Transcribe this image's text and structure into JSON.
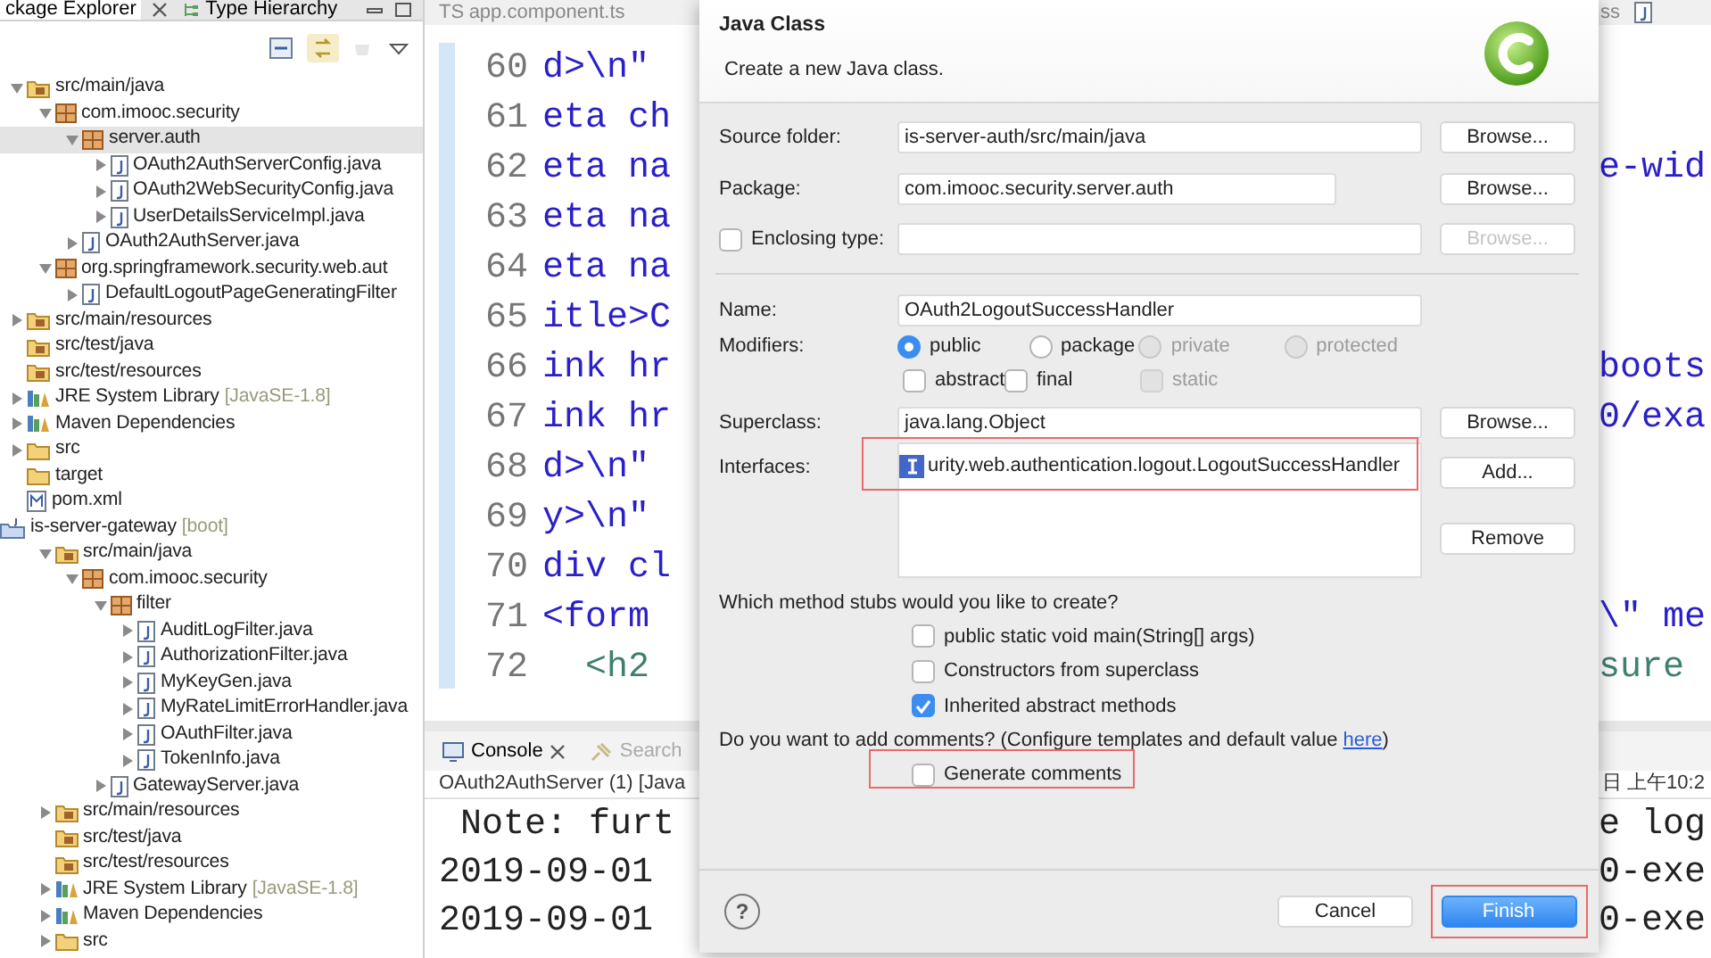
{
  "package_explorer": {
    "tabs": [
      {
        "label": "ckage Explorer",
        "selected": true
      },
      {
        "label": "Type Hierarchy",
        "selected": false
      }
    ],
    "tree": [
      {
        "label": "src/main/java",
        "kind": "source-folder",
        "expanded": true,
        "selected": false,
        "children": [
          {
            "label": "com.imooc.security",
            "kind": "package",
            "expanded": true,
            "selected": false,
            "children": [
              {
                "label": "server.auth",
                "kind": "package",
                "expanded": true,
                "selected": true,
                "children": [
                  {
                    "label": "OAuth2AuthServerConfig.java",
                    "kind": "java-file",
                    "expanded": false,
                    "selected": false
                  },
                  {
                    "label": "OAuth2WebSecurityConfig.java",
                    "kind": "java-file",
                    "expanded": false,
                    "selected": false
                  },
                  {
                    "label": "UserDetailsServiceImpl.java",
                    "kind": "java-file",
                    "expanded": false,
                    "selected": false
                  }
                ]
              },
              {
                "label": "OAuth2AuthServer.java",
                "kind": "java-file",
                "expanded": false,
                "selected": false
              }
            ]
          },
          {
            "label": "org.springframework.security.web.aut",
            "kind": "package",
            "expanded": true,
            "selected": false,
            "children": [
              {
                "label": "DefaultLogoutPageGeneratingFilter",
                "kind": "java-file",
                "expanded": false,
                "selected": false
              }
            ]
          }
        ]
      },
      {
        "label": "src/main/resources",
        "kind": "source-folder",
        "expanded": false,
        "selected": false
      },
      {
        "label": "src/test/java",
        "kind": "source-folder",
        "selected": false
      },
      {
        "label": "src/test/resources",
        "kind": "source-folder",
        "selected": false
      },
      {
        "label": "JRE System Library",
        "decoration": "[JavaSE-1.8]",
        "kind": "library",
        "expanded": false,
        "selected": false
      },
      {
        "label": "Maven Dependencies",
        "kind": "library",
        "expanded": false,
        "selected": false
      },
      {
        "label": "src",
        "kind": "folder",
        "expanded": false,
        "selected": false
      },
      {
        "label": "target",
        "kind": "folder",
        "selected": false
      },
      {
        "label": "pom.xml",
        "kind": "xml-file",
        "selected": false
      },
      {
        "label": "is-server-gateway",
        "decoration": "[boot]",
        "kind": "project",
        "selected": false,
        "children": [
          {
            "label": "src/main/java",
            "kind": "source-folder",
            "expanded": true,
            "selected": false,
            "children": [
              {
                "label": "com.imooc.security",
                "kind": "package",
                "expanded": true,
                "selected": false,
                "children": [
                  {
                    "label": "filter",
                    "kind": "package",
                    "expanded": true,
                    "selected": false,
                    "children": [
                      {
                        "label": "AuditLogFilter.java",
                        "kind": "java-file",
                        "expanded": false,
                        "selected": false
                      },
                      {
                        "label": "AuthorizationFilter.java",
                        "kind": "java-file",
                        "expanded": false,
                        "selected": false
                      },
                      {
                        "label": "MyKeyGen.java",
                        "kind": "java-file",
                        "expanded": false,
                        "selected": false
                      },
                      {
                        "label": "MyRateLimitErrorHandler.java",
                        "kind": "java-file",
                        "expanded": false,
                        "selected": false
                      },
                      {
                        "label": "OAuthFilter.java",
                        "kind": "java-file",
                        "expanded": false,
                        "selected": false
                      },
                      {
                        "label": "TokenInfo.java",
                        "kind": "java-file",
                        "expanded": false,
                        "selected": false
                      }
                    ]
                  },
                  {
                    "label": "GatewayServer.java",
                    "kind": "java-file",
                    "expanded": false,
                    "selected": false
                  }
                ]
              }
            ]
          },
          {
            "label": "src/main/resources",
            "kind": "source-folder",
            "expanded": false,
            "selected": false
          },
          {
            "label": "src/test/java",
            "kind": "source-folder",
            "selected": false
          },
          {
            "label": "src/test/resources",
            "kind": "source-folder",
            "selected": false
          },
          {
            "label": "JRE System Library",
            "decoration": "[JavaSE-1.8]",
            "kind": "library",
            "expanded": false,
            "selected": false
          },
          {
            "label": "Maven Dependencies",
            "kind": "library",
            "expanded": false,
            "selected": false
          },
          {
            "label": "src",
            "kind": "folder",
            "expanded": false,
            "selected": false
          }
        ]
      }
    ]
  },
  "editor": {
    "tab": {
      "icon_text": "TS",
      "label": "app.component.ts"
    },
    "tab_2": {
      "label": "ss"
    },
    "lines": [
      {
        "number": "60",
        "left": "d>\\n\"",
        "kind": "string"
      },
      {
        "number": "61",
        "left": "eta ch",
        "kind": "string"
      },
      {
        "number": "62",
        "left": "eta na",
        "right": "e-wid",
        "kind": "string"
      },
      {
        "number": "63",
        "left": "eta na",
        "kind": "string"
      },
      {
        "number": "64",
        "left": "eta na",
        "kind": "string"
      },
      {
        "number": "65",
        "left": "itle>C",
        "kind": "string"
      },
      {
        "number": "66",
        "left": "ink hr",
        "right": "boots",
        "kind": "string"
      },
      {
        "number": "67",
        "left": "ink hr",
        "right": "0/exa",
        "kind": "string"
      },
      {
        "number": "68",
        "left": "d>\\n\"",
        "kind": "string"
      },
      {
        "number": "69",
        "left": "y>\\n\"",
        "kind": "string"
      },
      {
        "number": "70",
        "left": "div cl",
        "kind": "string"
      },
      {
        "number": "71",
        "left": "<form",
        "right": "\\\" me",
        "kind": "string"
      },
      {
        "number": "72",
        "left": "  <h2",
        "right": "sure",
        "kind": "tag"
      }
    ]
  },
  "console": {
    "tabs": [
      {
        "label": "Console",
        "selected": true
      },
      {
        "label": "Search",
        "selected": false
      }
    ],
    "title": "OAuth2AuthServer (1) [Java",
    "title_right": "日 上午10:2",
    "lines": [
      {
        "left": " Note: furt",
        "right": "e log"
      },
      {
        "left": "2019-09-01",
        "right": "0-exe"
      },
      {
        "left": "2019-09-01",
        "right": "0-exe"
      }
    ]
  },
  "dialog": {
    "title": "Java Class",
    "subtitle": "Create a new Java class.",
    "source_folder": {
      "label": "Source folder:",
      "value": "is-server-auth/src/main/java",
      "button": {
        "label": "Browse...",
        "disabled": false
      }
    },
    "package": {
      "label": "Package:",
      "value": "com.imooc.security.server.auth",
      "button": {
        "label": "Browse...",
        "disabled": false
      }
    },
    "enclosing_type": {
      "label": "Enclosing type:",
      "checked": false,
      "button": {
        "label": "Browse...",
        "disabled": true
      }
    },
    "name": {
      "label": "Name:",
      "value": "OAuth2LogoutSuccessHandler"
    },
    "modifiers": {
      "label": "Modifiers:",
      "access": [
        {
          "label": "public",
          "selected": true,
          "disabled": false
        },
        {
          "label": "package",
          "selected": false,
          "disabled": false
        },
        {
          "label": "private",
          "selected": false,
          "disabled": true
        },
        {
          "label": "protected",
          "selected": false,
          "disabled": true
        }
      ],
      "flags": [
        {
          "label": "abstract",
          "checked": false,
          "disabled": false
        },
        {
          "label": "final",
          "checked": false,
          "disabled": false
        },
        {
          "label": "static",
          "checked": false,
          "disabled": true
        }
      ]
    },
    "superclass": {
      "label": "Superclass:",
      "value": "java.lang.Object",
      "button": {
        "label": "Browse...",
        "disabled": false
      }
    },
    "interfaces": {
      "label": "Interfaces:",
      "highlighted": true,
      "items": [
        {
          "label": "urity.web.authentication.logout.LogoutSuccessHandler"
        }
      ],
      "buttons": [
        {
          "label": "Add..."
        },
        {
          "label": "Remove"
        }
      ]
    },
    "stubs": {
      "question": "Which method stubs would you like to create?",
      "options": [
        {
          "label": "public static void main(String[] args)",
          "checked": false
        },
        {
          "label": "Constructors from superclass",
          "checked": false
        },
        {
          "label": "Inherited abstract methods",
          "checked": true
        }
      ]
    },
    "comments": {
      "prefix": "Do you want to add comments? (Configure templates and default value ",
      "link": "here",
      "suffix": ")",
      "option": {
        "label": "Generate comments",
        "checked": false,
        "highlighted": true
      }
    },
    "footer": {
      "help": "?",
      "buttons": [
        {
          "label": "Cancel",
          "kind": "secondary"
        },
        {
          "label": "Finish",
          "kind": "primary",
          "highlighted": true
        }
      ]
    }
  }
}
